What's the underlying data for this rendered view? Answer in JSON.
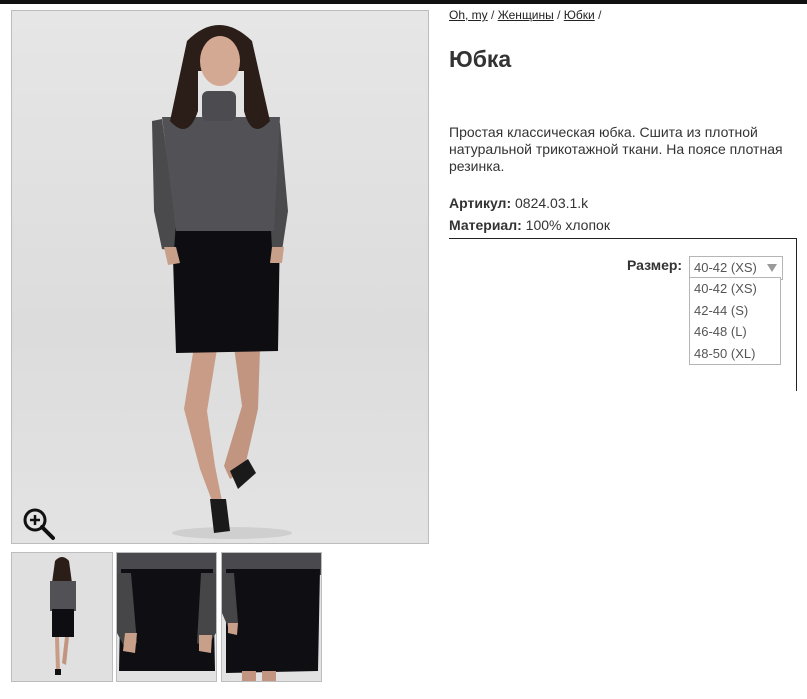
{
  "breadcrumb": {
    "item1": "Oh, my",
    "item2": "Женщины",
    "item3": "Юбки",
    "sep": "/"
  },
  "product": {
    "title": "Юбка",
    "description": "Простая классическая юбка. Сшита из плотной натуральной трикотажной ткани. На поясе плотная резинка.",
    "article_label": "Артикул:",
    "article_value": "0824.03.1.k",
    "material_label": "Материал:",
    "material_value": "100% хлопок"
  },
  "size": {
    "label": "Размер:",
    "selected": "40-42 (XS)",
    "options": [
      "40-42 (XS)",
      "42-44 (S)",
      "46-48 (L)",
      "48-50 (XL)"
    ]
  },
  "icons": {
    "zoom": "zoom-in-icon",
    "dropdown": "chevron-down-icon"
  },
  "colors": {
    "accent_bar": "#111111",
    "border": "#bdbdbd",
    "text": "#333333"
  }
}
